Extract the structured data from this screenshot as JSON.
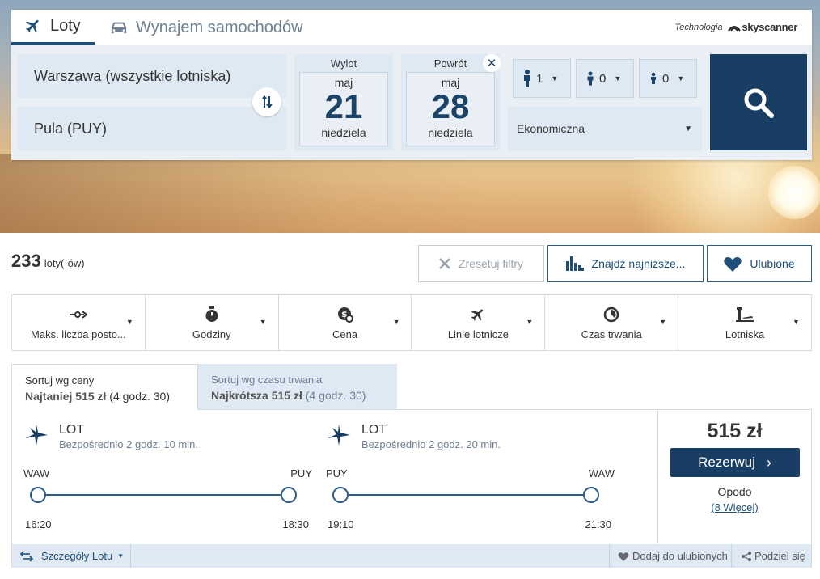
{
  "tabs": {
    "flights": "Loty",
    "car_rental": "Wynajem samochodów"
  },
  "powered_by": {
    "prefix": "Technologia",
    "brand": "skyscanner"
  },
  "search": {
    "from": "Warszawa (wszystkie lotniska)",
    "to": "Pula (PUY)",
    "departure": {
      "label": "Wylot",
      "month": "maj",
      "day": "21",
      "weekday": "niedziela"
    },
    "return": {
      "label": "Powrót",
      "month": "maj",
      "day": "28",
      "weekday": "niedziela"
    },
    "passengers": {
      "adults": "1",
      "children": "0",
      "infants": "0"
    },
    "cabin_class": "Ekonomiczna"
  },
  "results": {
    "count": "233",
    "count_unit": "loty(-ów)",
    "reset_filters": "Zresetuj filtry",
    "find_lowest": "Znajdź najniższe...",
    "favorites": "Ulubione"
  },
  "filters": [
    {
      "label": "Maks. liczba posto..."
    },
    {
      "label": "Godziny"
    },
    {
      "label": "Cena"
    },
    {
      "label": "Linie lotnicze"
    },
    {
      "label": "Czas trwania"
    },
    {
      "label": "Lotniska"
    }
  ],
  "sort": {
    "by_price": {
      "title": "Sortuj wg ceny",
      "bold": "Najtaniej 515 zł",
      "sub": "(4 godz. 30)"
    },
    "by_duration": {
      "title": "Sortuj wg czasu trwania",
      "bold": "Najkrótsza 515 zł",
      "sub": "(4 godz. 30)"
    }
  },
  "result": {
    "outbound": {
      "airline": "LOT",
      "info": "Bezpośrednio  2 godz. 10 min.",
      "from_code": "WAW",
      "to_code": "PUY",
      "dep_time": "16:20",
      "arr_time": "18:30"
    },
    "inbound": {
      "airline": "LOT",
      "info": "Bezpośrednio  2 godz. 20 min.",
      "from_code": "PUY",
      "to_code": "WAW",
      "dep_time": "19:10",
      "arr_time": "21:30"
    },
    "price": "515 zł",
    "book_label": "Rezerwuj",
    "provider": "Opodo",
    "more": "(8 Więcej)",
    "details": "Szczegóły Lotu",
    "add_favorite": "Dodaj do ulubionych",
    "share": "Podziel się"
  },
  "colors": {
    "brand_dark": "#183e64",
    "accent": "#2c5c8a",
    "panel_bg": "#dfe9f3"
  }
}
